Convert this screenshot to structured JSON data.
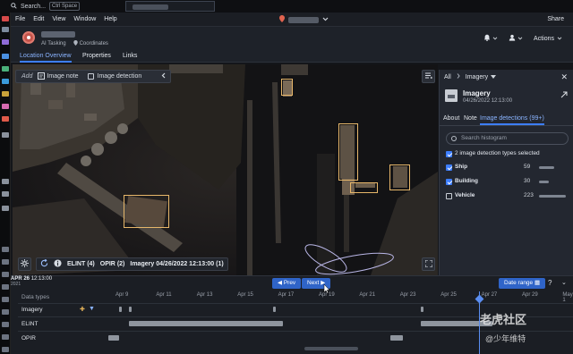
{
  "topbar": {
    "search": "Search...",
    "shortcut": "Ctrl Space"
  },
  "menubar": {
    "items": [
      "File",
      "Edit",
      "View",
      "Window",
      "Help"
    ],
    "share": "Share"
  },
  "header": {
    "subtitle": "AI Tasking",
    "coordinates": "Coordinates",
    "actions": "Actions"
  },
  "tabs": [
    "Location Overview",
    "Properties",
    "Links"
  ],
  "map_toolbar": {
    "add": "Add",
    "image_note": "Image note",
    "image_detection": "Image detection"
  },
  "map_bottom": {
    "elint": "ELINT",
    "elint_count": "(4)",
    "opir": "OPIR",
    "opir_count": "(2)",
    "imagery": "Imagery",
    "imagery_date": "04/26/2022 12:13:00",
    "imagery_count": "(1)"
  },
  "panel": {
    "breadcrumb_all": "All",
    "breadcrumb_current": "Imagery",
    "title": "Imagery",
    "date": "04/26/2022 12:13:00",
    "tabs": [
      "About",
      "Note",
      "Image detections (99+)"
    ],
    "search_placeholder": "Search histogram",
    "selected_text": "2 image detection types selected",
    "rows": [
      {
        "label": "Ship",
        "count": "59",
        "checked": true,
        "bar": 0.55
      },
      {
        "label": "Building",
        "count": "30",
        "checked": true,
        "bar": 0.35
      },
      {
        "label": "Vehicle",
        "count": "223",
        "checked": false,
        "bar": 1.0
      }
    ]
  },
  "timeline": {
    "date_label": "APR 26",
    "time_label": "12:13:00",
    "year_label": "2021",
    "prev": "Prev",
    "next": "Next",
    "date_range": "Date range",
    "header": "Data types",
    "ticks": [
      "Apr 9",
      "Apr 11",
      "Apr 13",
      "Apr 15",
      "Apr 17",
      "Apr 19",
      "Apr 21",
      "Apr 23",
      "Apr 25",
      "Apr 27",
      "Apr 29",
      "May 1"
    ],
    "rows": [
      "Imagery",
      "ELINT",
      "OPIR"
    ]
  },
  "watermark": {
    "brand": "老虎社区",
    "user": "@少年维特"
  }
}
